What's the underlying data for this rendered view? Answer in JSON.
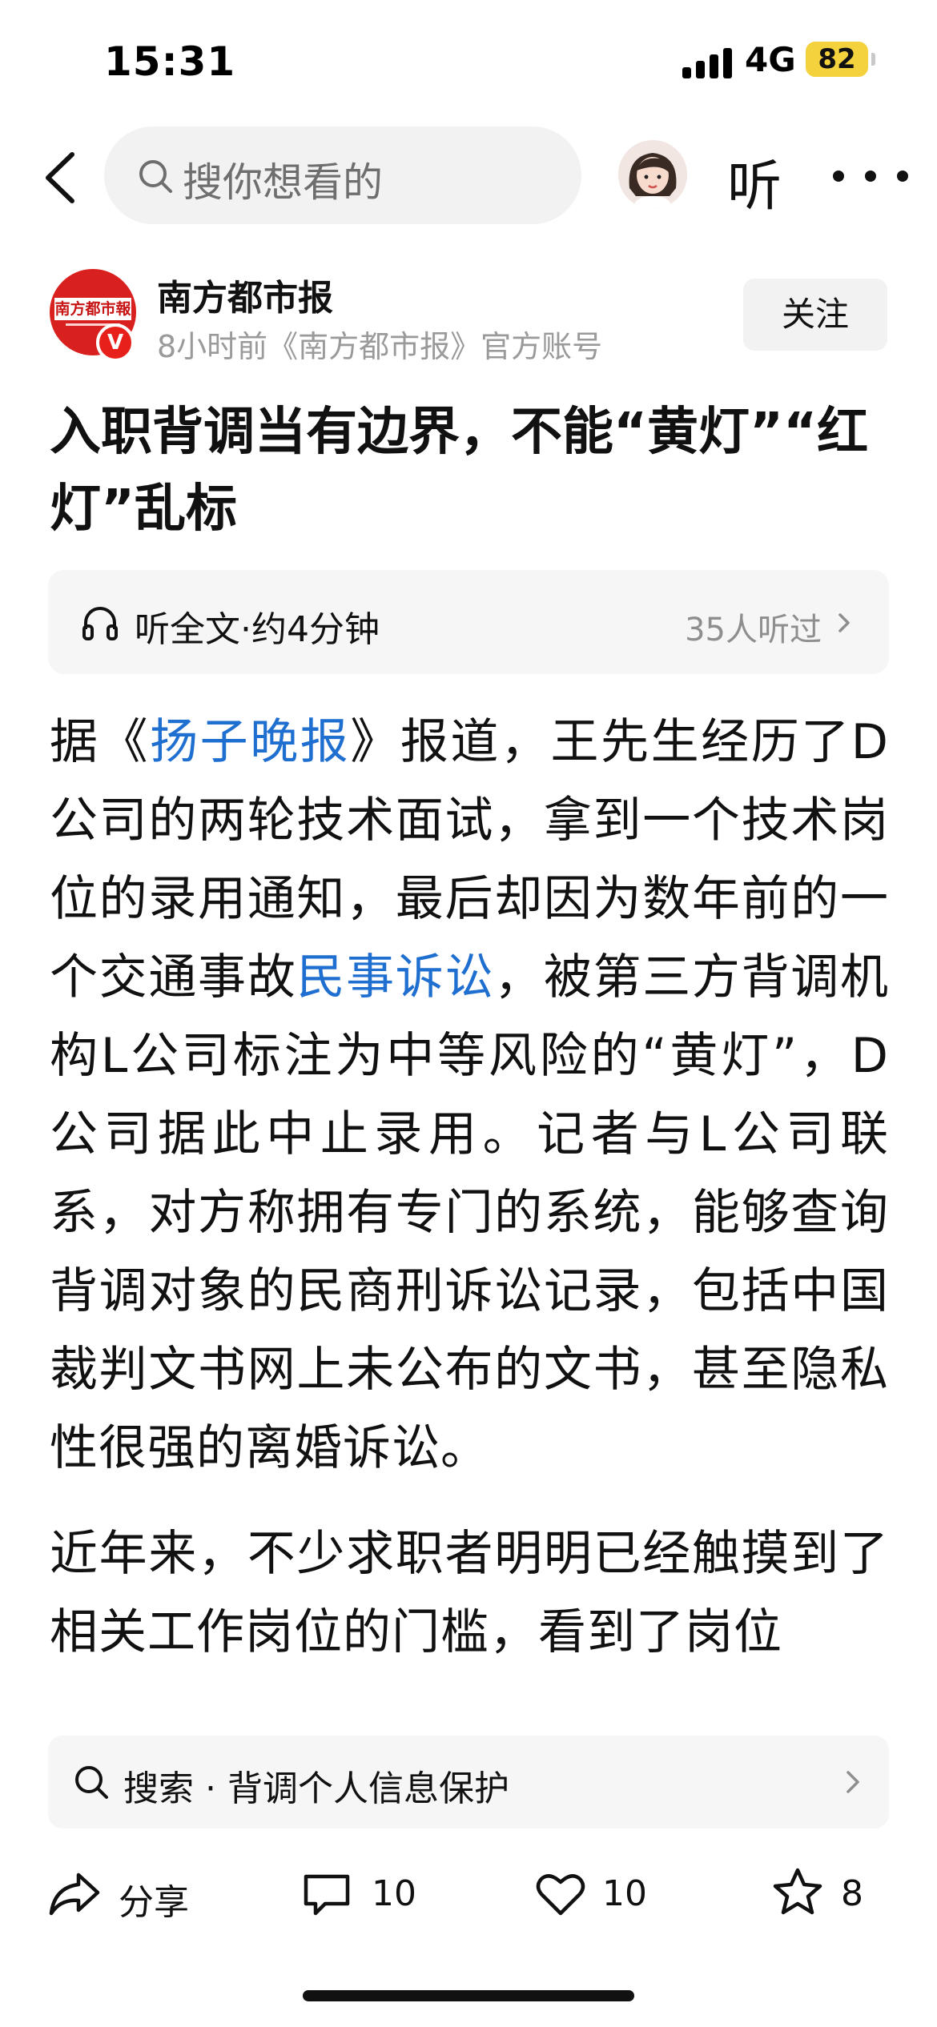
{
  "status_bar": {
    "time": "15:31",
    "network": "4G",
    "battery": "82"
  },
  "nav": {
    "search_placeholder": "搜你想看的",
    "listen_label": "听"
  },
  "author": {
    "name": "南方都市报",
    "meta": "8小时前《南方都市报》官方账号",
    "logo_text": "南方都市報",
    "verified_badge": "V",
    "follow_label": "关注"
  },
  "article": {
    "title": "入职背调当有边界，不能“黄灯”“红灯”乱标",
    "listen_bar": {
      "text": "听全文·约4分钟",
      "count": "35人听过"
    },
    "para1": {
      "t1": "据《",
      "link1": "扬子晚报",
      "t2": "》报道，王先生经历了D公司的两轮技术面试，拿到一个技术岗位的录用通知，最后却因为数年前的一个交通事故",
      "link2": "民事诉讼",
      "t3": "，被第三方背调机构L公司标注为中等风险的“黄灯”，D公司据此中止录用。记者与L公司联系，对方称拥有专门的系统，能够查询背调对象的民商刑诉讼记录，包括中国裁判文书网上未公布的文书，甚至隐私性很强的离婚诉讼。"
    },
    "para2": "近年来，不少求职者明明已经触摸到了相关工作岗位的门槛，看到了岗位"
  },
  "search_suggestion": {
    "prefix": "搜索",
    "separator": "·",
    "query": "背调个人信息保护"
  },
  "actions": {
    "share_label": "分享",
    "comment_count": "10",
    "like_count": "10",
    "favorite_count": "8"
  },
  "colors": {
    "link": "#1f6fd1",
    "battery": "#f4d23e",
    "logo_red": "#d8201e"
  }
}
